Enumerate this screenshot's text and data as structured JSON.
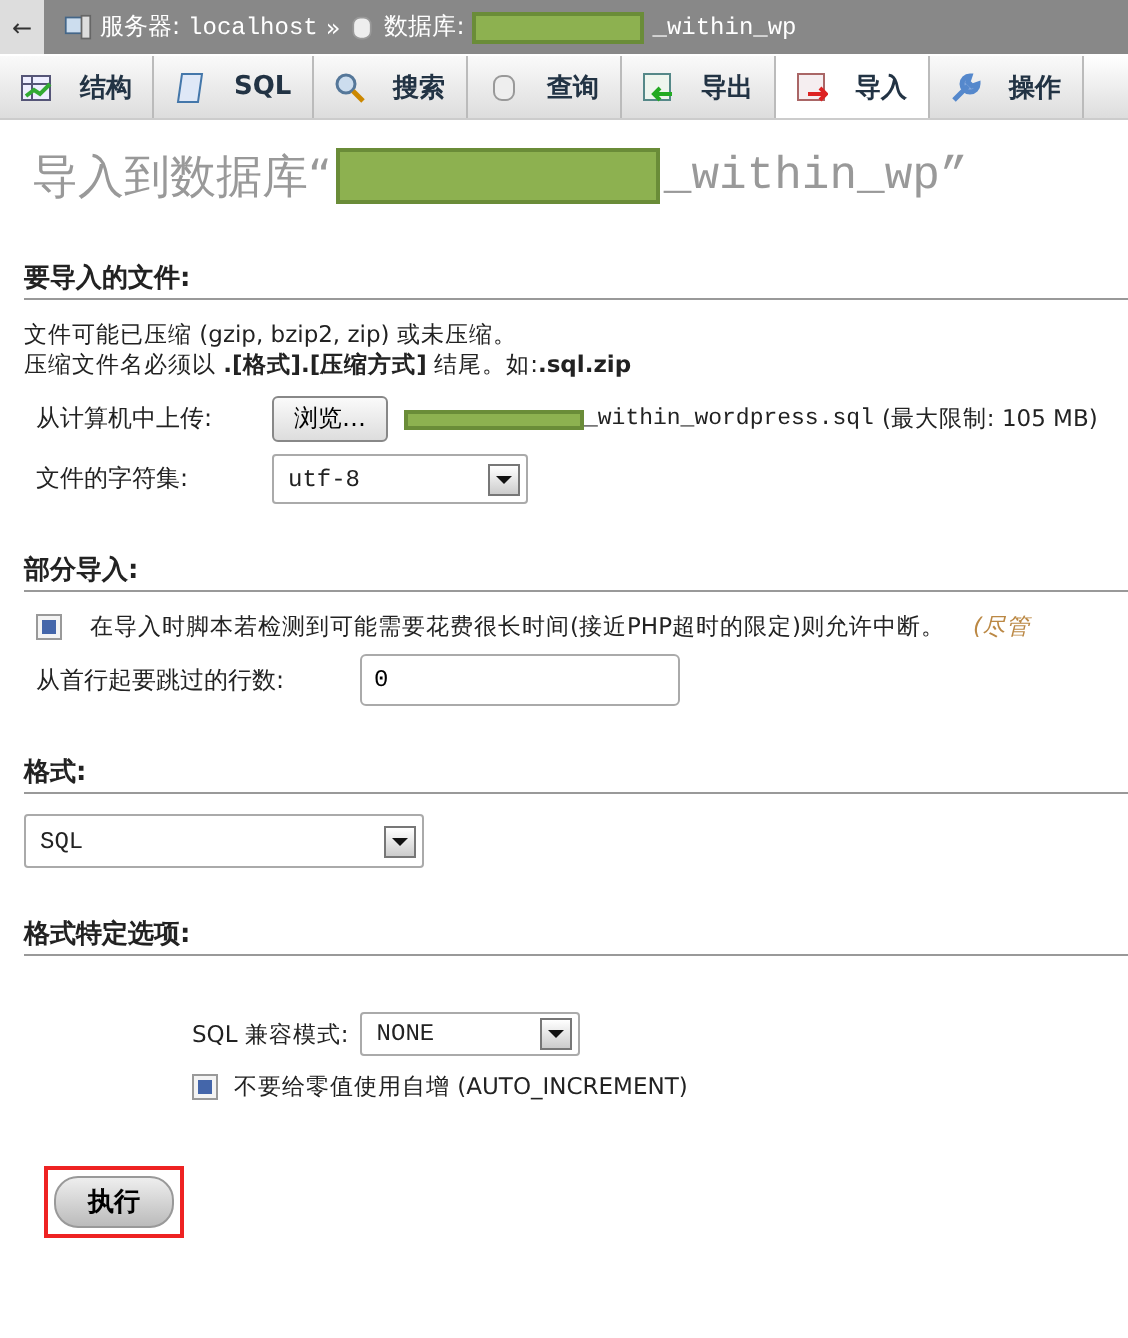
{
  "breadcrumb": {
    "back": "←",
    "server_label": "服务器:",
    "server": "localhost",
    "separator": "»",
    "db_label": "数据库:",
    "db_suffix": "_within_wp"
  },
  "tabs": [
    {
      "label": "结构",
      "kind": "structure",
      "selected": false
    },
    {
      "label": "SQL",
      "kind": "sql",
      "selected": false
    },
    {
      "label": "搜索",
      "kind": "search",
      "selected": false
    },
    {
      "label": "查询",
      "kind": "query",
      "selected": false
    },
    {
      "label": "导出",
      "kind": "export",
      "selected": false
    },
    {
      "label": "导入",
      "kind": "import",
      "selected": true
    },
    {
      "label": "操作",
      "kind": "operations",
      "selected": false
    }
  ],
  "heading": {
    "prefix": "导入到数据库“",
    "suffix": "_within_wp”"
  },
  "file_section": {
    "title": "要导入的文件:",
    "note1": "文件可能已压缩 (gzip, bzip2, zip) 或未压缩。",
    "note2": "压缩文件名必须以 **.[格式].[压缩方式]** 结尾。如:**.sql.zip**",
    "upload_label": "从计算机中上传:",
    "browse": "浏览…",
    "filename": "_within_wordpress.sql",
    "limit": "(最大限制: 105 MB)",
    "charset_label": "文件的字符集:",
    "charset": "utf-8"
  },
  "partial_section": {
    "title": "部分导入:",
    "allow_interrupt": {
      "label": "在导入时脚本若检测到可能需要花费很长时间(接近PHP超时的限定)则允许中断。",
      "hint": "(尽管",
      "checked": true
    },
    "skip_label": "从首行起要跳过的行数:",
    "skip_value": "0"
  },
  "format_section": {
    "title": "格式:",
    "format": "SQL"
  },
  "options_section": {
    "title": "格式特定选项:",
    "compat_label": "SQL 兼容模式:",
    "compat": "NONE",
    "no_auto_value": {
      "label": "不要给零值使用自增 (AUTO_INCREMENT)",
      "checked": true
    }
  },
  "submit": {
    "label": "执行",
    "highlighted": true
  }
}
